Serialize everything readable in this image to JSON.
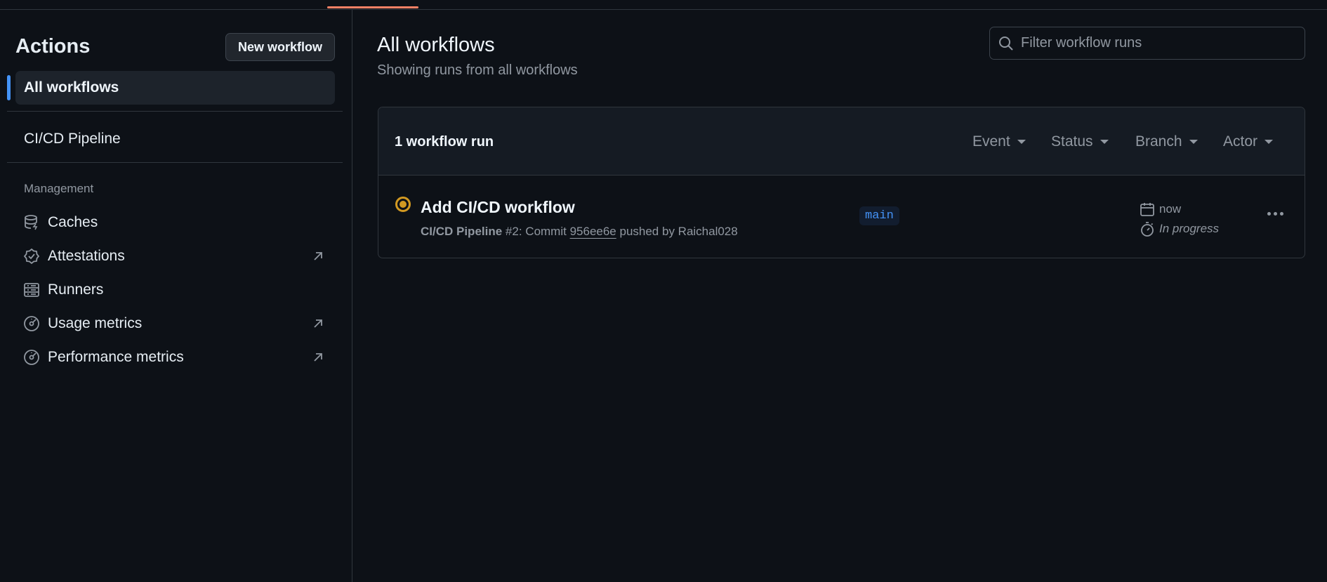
{
  "sidebar": {
    "title": "Actions",
    "new_workflow_label": "New workflow",
    "all_workflows_label": "All workflows",
    "workflows": [
      "CI/CD Pipeline"
    ],
    "management_label": "Management",
    "management_items": [
      {
        "label": "Caches",
        "icon": "database-icon",
        "external": false
      },
      {
        "label": "Attestations",
        "icon": "verified-badge-icon",
        "external": true
      },
      {
        "label": "Runners",
        "icon": "server-icon",
        "external": false
      },
      {
        "label": "Usage metrics",
        "icon": "meter-icon",
        "external": true
      },
      {
        "label": "Performance metrics",
        "icon": "meter-icon",
        "external": true
      }
    ]
  },
  "main": {
    "title": "All workflows",
    "subtitle": "Showing runs from all workflows",
    "filter_placeholder": "Filter workflow runs",
    "runs_count": "1 workflow run",
    "filters": [
      "Event",
      "Status",
      "Branch",
      "Actor"
    ],
    "runs": [
      {
        "title": "Add CI/CD workflow",
        "workflow_name": "CI/CD Pipeline",
        "run_number": "#2",
        "meta_mid": ": Commit ",
        "commit_sha": "956ee6e",
        "meta_tail": " pushed by Raichal028",
        "branch": "main",
        "time": "now",
        "status": "In progress",
        "status_color": "#d29922"
      }
    ]
  },
  "colors": {
    "accent": "#4493f8",
    "tab_underline": "#f78166",
    "in_progress": "#d29922"
  }
}
